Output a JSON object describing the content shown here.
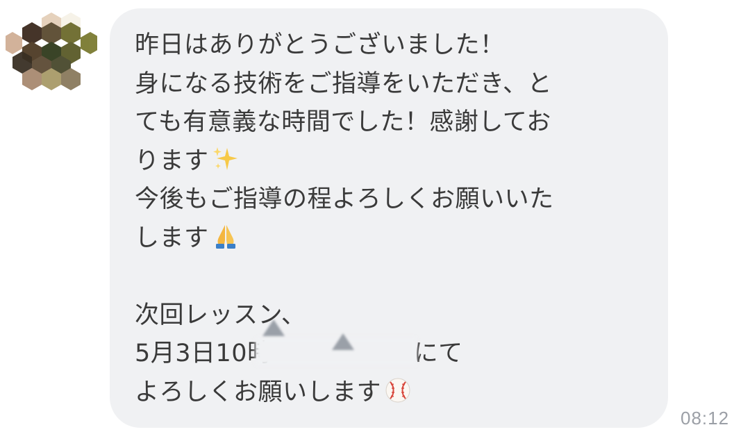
{
  "message": {
    "lines": [
      "昨日はありがとうございました！",
      "身になる技術をご指導をいただき、と",
      "ても有意義な時間でした！感謝してお",
      "ります",
      "今後もご指導の程よろしくお願いいた",
      "します",
      "",
      "次回レッスン、",
      "5月3日10時",
      "にて",
      "よろしくお願いします"
    ],
    "emojis": [
      "sparkles-emoji",
      "folded-hands-emoji",
      "baseball-emoji"
    ]
  },
  "timestamp": "08:12",
  "colors": {
    "bubble": "#f0f1f3",
    "text": "#3a3a3a",
    "timestamp": "#9b9fa6"
  }
}
